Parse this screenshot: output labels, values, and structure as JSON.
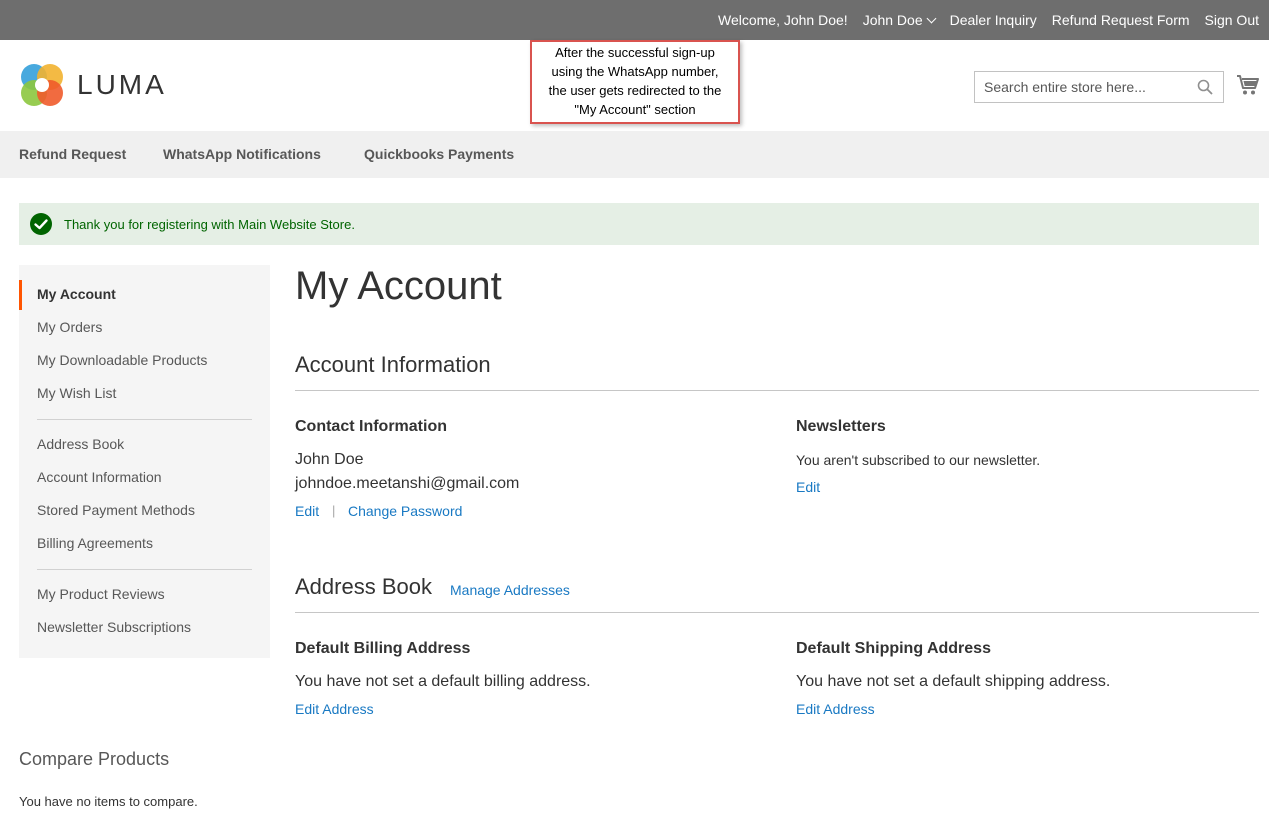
{
  "topbar": {
    "welcome": "Welcome, John Doe!",
    "account_name": "John Doe",
    "dealer_inquiry": "Dealer Inquiry",
    "refund_request_form": "Refund Request Form",
    "sign_out": "Sign Out"
  },
  "header": {
    "logo_text": "LUMA",
    "search_placeholder": "Search entire store here...",
    "callout_lines": [
      "After the successful sign-up",
      "using the WhatsApp number,",
      "the user gets redirected to the",
      "\"My Account\" section"
    ]
  },
  "nav": {
    "items": [
      "Refund Request",
      "WhatsApp Notifications",
      "Quickbooks Payments"
    ]
  },
  "message": {
    "text": "Thank you for registering with Main Website Store."
  },
  "sidebar": {
    "items": [
      "My Account",
      "My Orders",
      "My Downloadable Products",
      "My Wish List",
      "Address Book",
      "Account Information",
      "Stored Payment Methods",
      "Billing Agreements",
      "My Product Reviews",
      "Newsletter Subscriptions"
    ]
  },
  "main": {
    "page_title": "My Account",
    "account_info": {
      "title": "Account Information",
      "contact": {
        "title": "Contact Information",
        "name": "John Doe",
        "email": "johndoe.meetanshi@gmail.com",
        "edit": "Edit",
        "separator": "|",
        "change_password": "Change Password"
      },
      "newsletters": {
        "title": "Newsletters",
        "text": "You aren't subscribed to our newsletter.",
        "edit": "Edit"
      }
    },
    "address_book": {
      "title": "Address Book",
      "manage": "Manage Addresses",
      "billing": {
        "title": "Default Billing Address",
        "text": "You have not set a default billing address.",
        "edit": "Edit Address"
      },
      "shipping": {
        "title": "Default Shipping Address",
        "text": "You have not set a default shipping address.",
        "edit": "Edit Address"
      }
    }
  },
  "compare": {
    "title": "Compare Products",
    "text": "You have no items to compare."
  },
  "colors": {
    "topbar": "#6e6e6e",
    "link": "#1979c3",
    "active_accent": "#ff5501",
    "success_bg": "#e5efe5",
    "success_text": "#006400",
    "callout_border": "#d9534f"
  }
}
